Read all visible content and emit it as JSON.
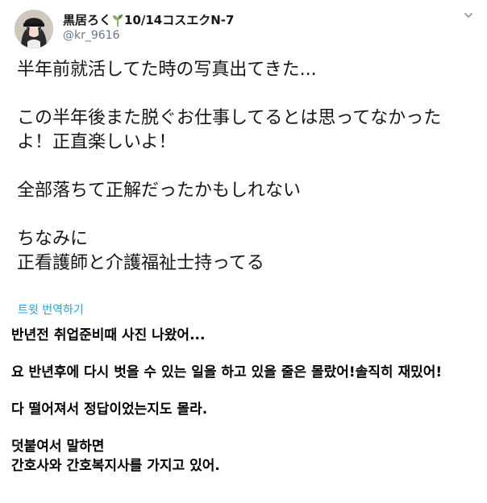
{
  "tweet": {
    "display_name": "黒居ろく",
    "display_name_suffix": "10/14コスエクN-7",
    "handle": "@kr_9616",
    "text_paragraphs": [
      "半年前就活してた時の写真出てきた...",
      "この半年後また脱ぐお仕事してるとは思ってなかったよ！正直楽しいよ！",
      "全部落ちて正解だったかもしれない",
      "ちなみに\n正看護師と介護福祉士持ってる"
    ],
    "translate_label": "트윗 번역하기"
  },
  "translation": {
    "paragraphs": [
      "반년전 취업준비때 사진 나왔어...",
      "요 반년후에 다시 벗을 수 있는 일을 하고 있을 줄은 몰랐어!솔직히 재밌어!",
      "다 떨어져서 정답이었는지도 몰라.",
      "덧붙여서 말하면\n간호사와 간호복지사를 가지고 있어."
    ]
  },
  "icons": {
    "avatar": "profile-photo",
    "name_emoji": "sprout-icon",
    "menu": "chevron-down-icon"
  },
  "colors": {
    "link": "#1da1f2",
    "handle": "#657786",
    "text": "#14171a",
    "sprout": "#77b255"
  }
}
